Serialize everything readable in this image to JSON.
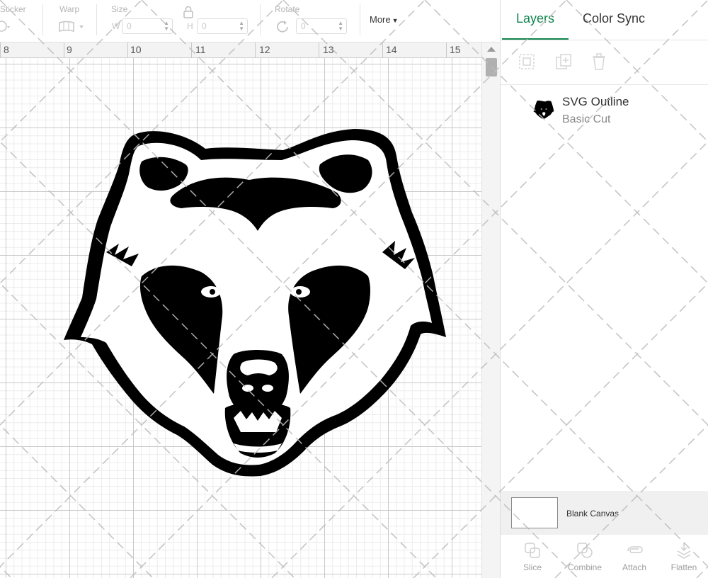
{
  "toolbar": {
    "sticker_label": "Sticker",
    "warp_label": "Warp",
    "size_label": "Size",
    "size_w_prefix": "W",
    "size_w_value": "0",
    "size_h_prefix": "H",
    "size_h_value": "0",
    "rotate_label": "Rotate",
    "rotate_value": "0",
    "more_label": "More"
  },
  "ruler": {
    "labels": [
      "8",
      "9",
      "10",
      "11",
      "12",
      "13",
      "14",
      "15"
    ]
  },
  "panel": {
    "tabs": [
      "Layers",
      "Color Sync"
    ],
    "active_tab": "Layers",
    "layer": {
      "name": "SVG Outline",
      "operation": "Basic Cut",
      "thumbnail_icon": "bear-head-icon"
    },
    "blank_canvas_label": "Blank Canvas",
    "bottom_actions": [
      "Slice",
      "Combine",
      "Attach",
      "Flatten"
    ]
  },
  "canvas": {
    "design_icon": "bear-head-icon"
  },
  "colors": {
    "accent": "#12854e",
    "design": "#000000"
  }
}
